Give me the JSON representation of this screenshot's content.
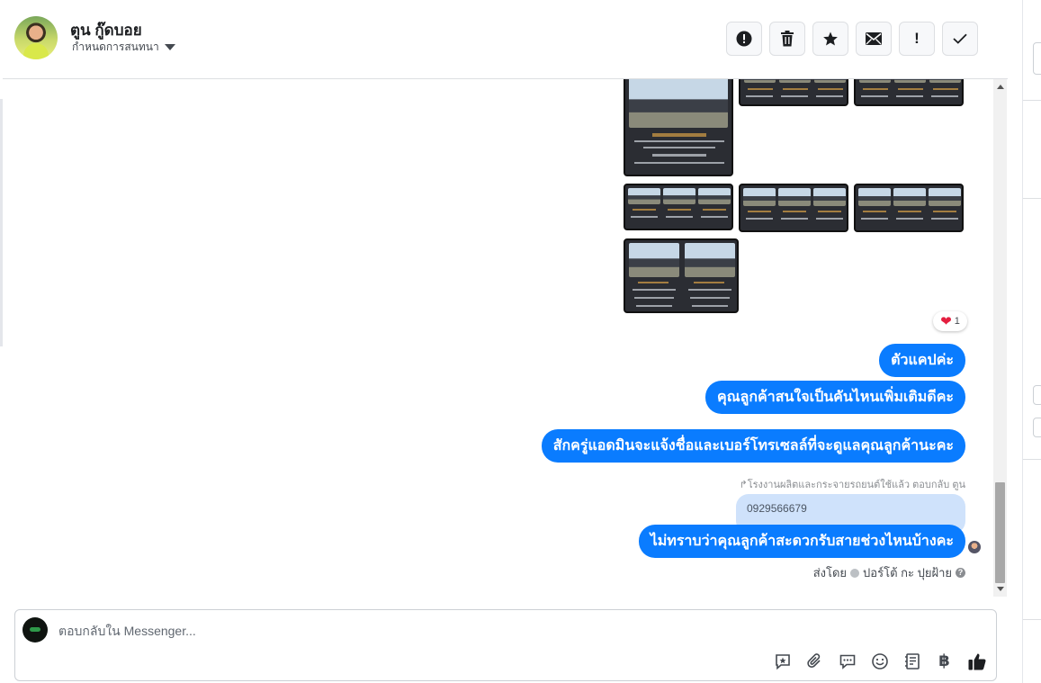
{
  "header": {
    "contact_name": "ตูน กู๊ดบอย",
    "subtitle": "กำหนดการสนทนา"
  },
  "toolbar": [
    {
      "icon": "alert-circle-icon"
    },
    {
      "icon": "trash-icon"
    },
    {
      "icon": "star-icon"
    },
    {
      "icon": "envelope-icon"
    },
    {
      "icon": "exclamation-icon",
      "label": "!"
    },
    {
      "icon": "check-icon"
    }
  ],
  "reaction": {
    "emoji": "❤",
    "count": "1"
  },
  "messages": [
    {
      "text": "ตัวแคปค่ะ"
    },
    {
      "text": "คุณลูกค้าสนใจเป็นคันไหนเพิ่มเติมดีคะ"
    },
    {
      "text": "สักครู่แอดมินจะแจ้งชื่อและเบอร์โทรเซลล์ที่จะดูแลคุณลูกค้านะคะ"
    },
    {
      "text": "ไม่ทราบว่าคุณลูกค้าสะดวกรับสายช่วงไหนบ้างคะ"
    }
  ],
  "reply": {
    "meta": "โรงงานผลิตและกระจายรถยนต์ใช้แล้ว ตอบกลับ ตูน",
    "quoted": "0929566679"
  },
  "sent_by": {
    "prefix": "ส่งโดย",
    "name": "ปอร์โต้ กะ ปุยฝ้าย"
  },
  "composer": {
    "placeholder": "ตอบกลับใน Messenger..."
  },
  "composer_tools": [
    "saved-reply-icon",
    "attachment-icon",
    "chat-bubble-icon",
    "emoji-icon",
    "notes-icon",
    "baht-icon",
    "like-icon"
  ],
  "colors": {
    "accent": "#0a7cff",
    "quoted_bg": "#cfe2fb",
    "heart": "#e41e3f"
  }
}
